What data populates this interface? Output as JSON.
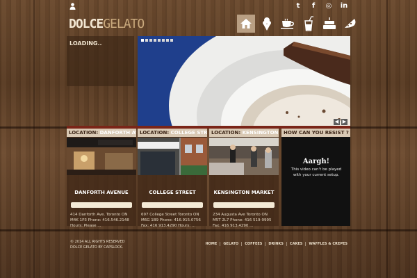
{
  "brand": {
    "logo_bold": "DOLCE",
    "logo_light": "GELATO"
  },
  "social": [
    {
      "label": "t",
      "icon": "twitter-icon"
    },
    {
      "label": "f",
      "icon": "facebook-icon"
    },
    {
      "label": "◎",
      "icon": "instagram-icon"
    },
    {
      "label": "in",
      "icon": "linkedin-icon"
    }
  ],
  "nav": [
    "home-icon",
    "gelato-icon",
    "coffee-icon",
    "drinks-icon",
    "cakes-icon",
    "crepes-icon"
  ],
  "loading": "LOADING..",
  "hero": {
    "dot_count": 8
  },
  "locations": [
    {
      "prefix": "LOCATION:",
      "name": "DANFORTH AVENUE",
      "place": "DANFORTH AVENUE",
      "address": "414 Danforth Ave. Toronto ON M4K 1P3 Phone: 416.546.2148 Hours: Please ..."
    },
    {
      "prefix": "LOCATION:",
      "name": "COLLEGE STREET",
      "place": "COLLEGE STREET",
      "address": "697 College Street Toronto ON M6G 1B9 Phone: 416.915.0756 Fax: 416 913.4290 Hours: ..."
    },
    {
      "prefix": "LOCATION:",
      "name": "KENSINGTON MRKT",
      "place": "KENSINGTON MARKET",
      "address": "234 Augusta Ave Toronto ON M5T 2L7 Phone: 416 519-9995 Fax: 416 913.4290 ..."
    }
  ],
  "video": {
    "header": "HOW CAN YOU RESIST ?",
    "title": "Aargh!",
    "message": "This video can't be played with your current setup."
  },
  "footer": {
    "copyright": "© 2014 ALL RIGHTS RESERVED",
    "credit": "DOLCE GELATO BY CAPSLOCK.",
    "links": [
      "HOME",
      "GELATO",
      "COFFEES",
      "DRINKS",
      "CAKES",
      "WAFFLES & CREPES"
    ]
  }
}
